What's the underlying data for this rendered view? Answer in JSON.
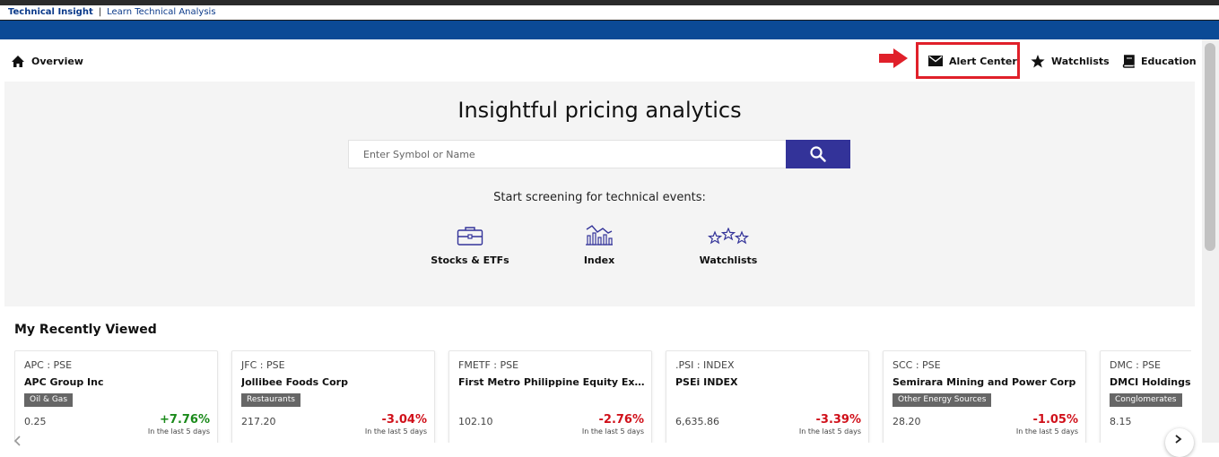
{
  "toplinks": {
    "brand": "Technical Insight",
    "separator": "|",
    "learn": "Learn Technical Analysis"
  },
  "nav": {
    "overview": "Overview",
    "alert_center": "Alert Center",
    "watchlists": "Watchlists",
    "education": "Education"
  },
  "icons": {
    "overview": "home-icon",
    "alert_center": "envelope-icon",
    "watchlists": "star-icon",
    "education": "book-icon",
    "search": "search-icon",
    "annotation_arrow": "arrow-right-icon"
  },
  "colors": {
    "brand_blue": "#0b4a96",
    "search_button": "#333399",
    "highlight": "#e0202a",
    "positive": "#1a8a1a",
    "negative": "#d0101a"
  },
  "hero": {
    "title": "Insightful pricing analytics",
    "search_placeholder": "Enter Symbol or Name",
    "screen_label": "Start screening for technical events:",
    "options": [
      {
        "label": "Stocks & ETFs",
        "icon": "briefcase-icon"
      },
      {
        "label": "Index",
        "icon": "index-chart-icon"
      },
      {
        "label": "Watchlists",
        "icon": "stars-outline-icon"
      }
    ]
  },
  "recent": {
    "title": "My Recently Viewed",
    "cards": [
      {
        "symbol": "APC : PSE",
        "name": "APC Group Inc",
        "tag": "Oil & Gas",
        "price": "0.25",
        "change": "+7.76%",
        "direction": "up",
        "period": "In the last 5 days"
      },
      {
        "symbol": "JFC : PSE",
        "name": "Jollibee Foods Corp",
        "tag": "Restaurants",
        "price": "217.20",
        "change": "-3.04%",
        "direction": "down",
        "period": "In the last 5 days"
      },
      {
        "symbol": "FMETF : PSE",
        "name": "First Metro Philippine Equity Exchang…",
        "tag": "",
        "price": "102.10",
        "change": "-2.76%",
        "direction": "down",
        "period": "In the last 5 days"
      },
      {
        "symbol": ".PSI : INDEX",
        "name": "PSEi INDEX",
        "tag": "",
        "price": "6,635.86",
        "change": "-3.39%",
        "direction": "down",
        "period": "In the last 5 days"
      },
      {
        "symbol": "SCC : PSE",
        "name": "Semirara Mining and Power Corp",
        "tag": "Other Energy Sources",
        "price": "28.20",
        "change": "-1.05%",
        "direction": "down",
        "period": "In the last 5 days"
      },
      {
        "symbol": "DMC : PSE",
        "name": "DMCI Holdings Inc",
        "tag": "Conglomerates",
        "price": "8.15",
        "change": "",
        "direction": "",
        "period": ""
      }
    ]
  }
}
